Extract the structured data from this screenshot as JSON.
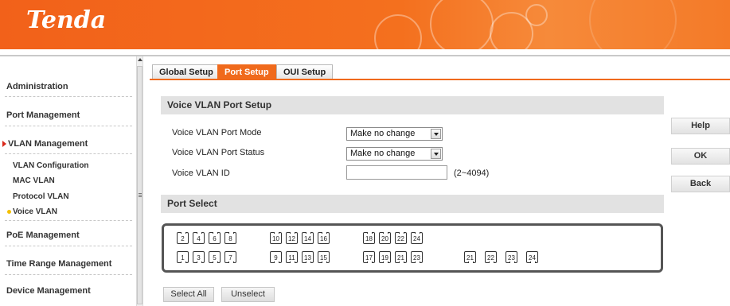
{
  "header": {
    "logo_text": "Tenda",
    "brand_color": "#f06a1c"
  },
  "sidebar": {
    "items": [
      {
        "label": "Administration"
      },
      {
        "label": "Port Management"
      },
      {
        "label": "VLAN Management",
        "active": true
      },
      {
        "label": "PoE Management"
      },
      {
        "label": "Time Range Management"
      },
      {
        "label": "Device Management"
      }
    ],
    "sub_items": [
      {
        "label": "VLAN Configuration"
      },
      {
        "label": "MAC VLAN"
      },
      {
        "label": "Protocol VLAN"
      },
      {
        "label": "Voice VLAN",
        "active": true
      }
    ]
  },
  "tabs": [
    {
      "label": "Global Setup"
    },
    {
      "label": "Port Setup",
      "active": true
    },
    {
      "label": "OUI Setup"
    }
  ],
  "section_setup": {
    "title": "Voice VLAN Port Setup",
    "port_mode_label": "Voice VLAN Port Mode",
    "port_mode_value": "Make no change",
    "port_status_label": "Voice VLAN Port Status",
    "port_status_value": "Make no change",
    "vlan_id_label": "Voice VLAN ID",
    "vlan_id_value": "",
    "vlan_id_range": "(2~4094)"
  },
  "buttons": {
    "help": "Help",
    "ok": "OK",
    "back": "Back",
    "select_all": "Select All",
    "unselect": "Unselect"
  },
  "section_ports": {
    "title": "Port Select",
    "top_row": [
      "2",
      "4",
      "6",
      "8",
      "10",
      "12",
      "14",
      "16",
      "18",
      "20",
      "22",
      "24"
    ],
    "bottom_row": [
      "1",
      "3",
      "5",
      "7",
      "9",
      "11",
      "13",
      "15",
      "17",
      "19",
      "21",
      "23"
    ],
    "extra_ports": [
      "21",
      "22",
      "23",
      "24"
    ]
  }
}
